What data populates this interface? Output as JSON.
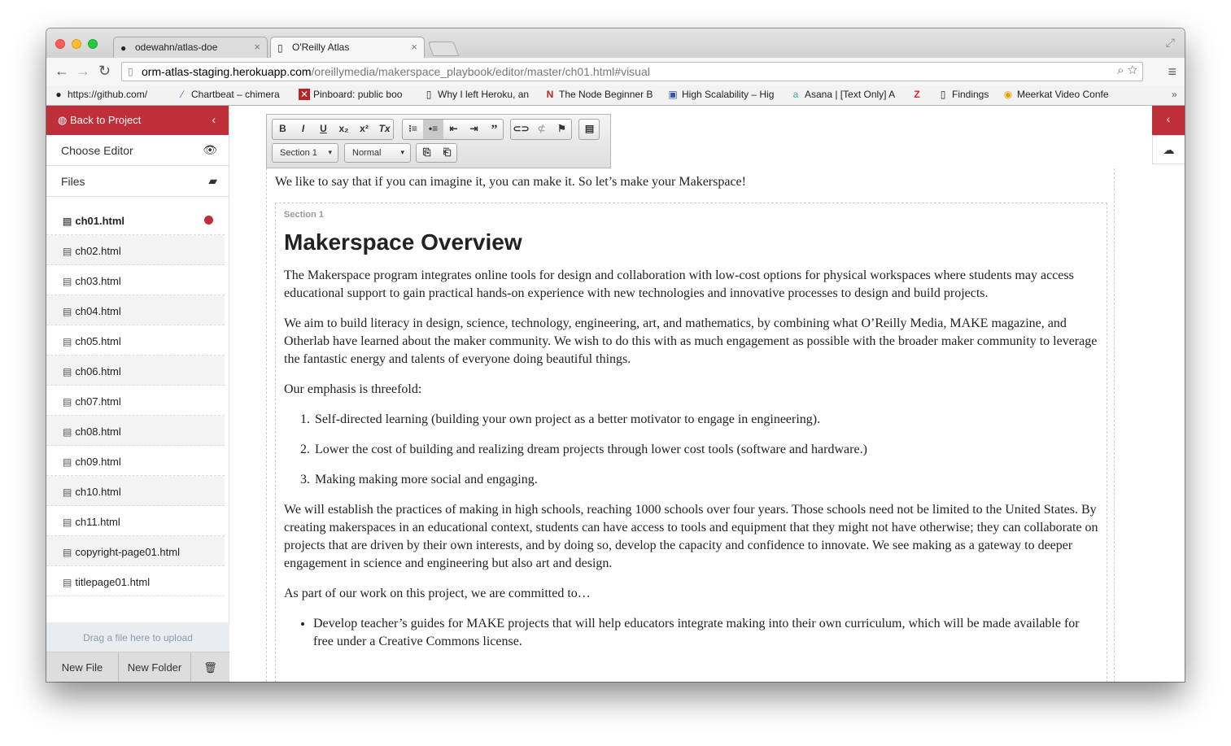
{
  "browser": {
    "tabs": [
      {
        "label": "odewahn/atlas-doe",
        "icon": "github-icon"
      },
      {
        "label": "O'Reilly Atlas",
        "icon": "page-icon"
      }
    ],
    "url_host": "orm-atlas-staging.herokuapp.com",
    "url_path": "/oreillymedia/makerspace_playbook/editor/master/ch01.html#visual",
    "bookmarks": [
      {
        "label": "https://github.com/",
        "icon": "github-icon"
      },
      {
        "label": "Chartbeat – chimera",
        "icon": "chartbeat-icon"
      },
      {
        "label": "Pinboard: public boo",
        "icon": "pinboard-icon"
      },
      {
        "label": "Why I left Heroku, an",
        "icon": "page-icon"
      },
      {
        "label": "The Node Beginner B",
        "icon": "n-icon"
      },
      {
        "label": "High Scalability – Hig",
        "icon": "highscalability-icon"
      },
      {
        "label": "Asana | [Text Only] A",
        "icon": "asana-icon"
      },
      {
        "label": "",
        "icon": "z-icon"
      },
      {
        "label": "Findings",
        "icon": "page-icon"
      },
      {
        "label": "Meerkat Video Confe",
        "icon": "meerkat-icon"
      }
    ]
  },
  "sidebar": {
    "back_label": "Back to Project",
    "choose_editor": "Choose Editor",
    "files_label": "Files",
    "files": [
      "ch01.html",
      "ch02.html",
      "ch03.html",
      "ch04.html",
      "ch05.html",
      "ch06.html",
      "ch07.html",
      "ch08.html",
      "ch09.html",
      "ch10.html",
      "ch11.html",
      "copyright-page01.html",
      "titlepage01.html"
    ],
    "current_file": "ch01.html",
    "dropzone": "Drag a file here to upload",
    "new_file": "New File",
    "new_folder": "New Folder"
  },
  "editor_toolbar": {
    "section_select": "Section 1",
    "style_select": "Normal"
  },
  "document": {
    "intro": "We like to say that if you can imagine it, you can make it. So let’s make your Makerspace!",
    "section_label": "Section 1",
    "title": "Makerspace Overview",
    "p1": "The Makerspace program integrates online tools for design and collaboration with low-cost options for physical workspaces where students may access educational support to gain practical hands-on experience with new technologies and innovative processes to design and build projects.",
    "p2": "We aim to build literacy in design, science, technology, engineering, art, and mathematics, by combining what O’Reilly Media, MAKE magazine, and Otherlab have learned about the maker community. We wish to do this with as much engagement as possible with the broader maker community to leverage the fantastic energy and talents of everyone doing beautiful things.",
    "p3": "Our emphasis is threefold:",
    "list": [
      "Self-directed learning (building your own project as a better motivator to engage in engineering).",
      "Lower the cost of building and realizing dream projects through lower cost tools (software and hardware.)",
      "Making making more social and engaging."
    ],
    "p4": "We will establish the practices of making in high schools, reaching 1000 schools over four years. Those schools need not be limited to the United States. By creating makerspaces in an educational context, students can have access to tools and equipment that they might not have otherwise; they can collaborate on projects that are driven by their own interests, and by doing so, develop the capacity and confidence to innovate. We see making as a gateway to deeper engagement in science and engineering but also art and design.",
    "p5": "As part of our work on this project, we are committed to…",
    "bullets": [
      "Develop teacher’s guides for MAKE projects that will help educators integrate making into their own curriculum, which will be made available for free under a Creative Commons license."
    ]
  },
  "colors": {
    "accent": "#bf2f3a"
  }
}
